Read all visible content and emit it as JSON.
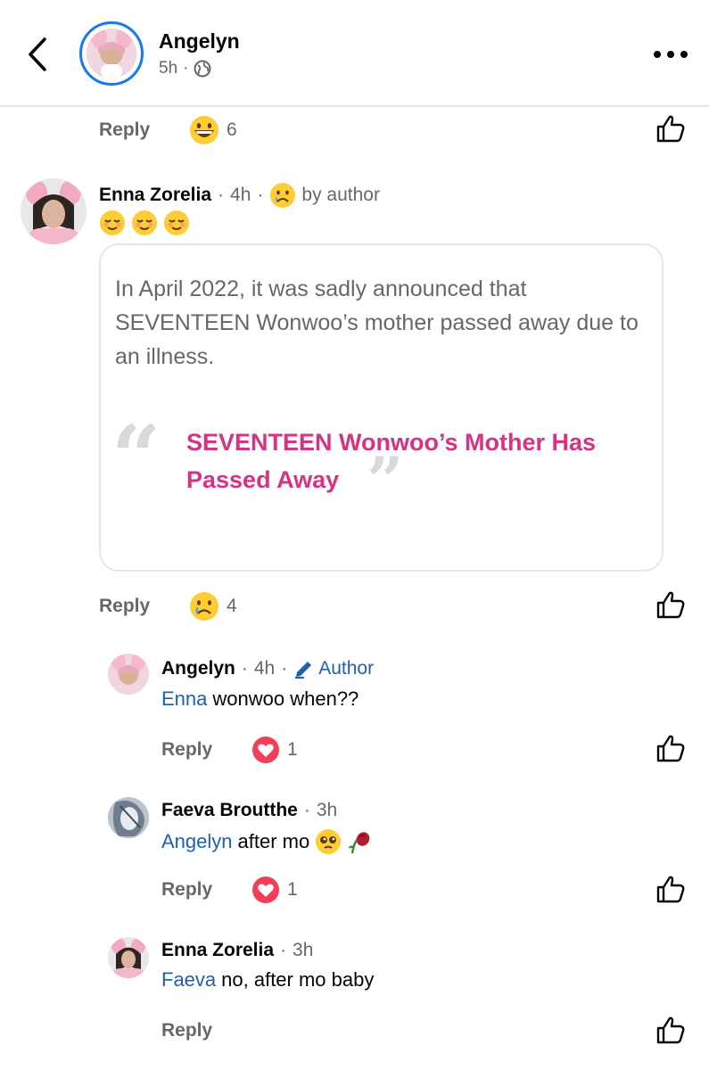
{
  "header": {
    "author": "Angelyn",
    "time": "5h",
    "separator": "·"
  },
  "top_actions": {
    "reply": "Reply",
    "reaction_count": "6",
    "reaction_icon": "grin-emoji"
  },
  "comment1": {
    "name": "Enna Zorelia",
    "time": "4h",
    "by_author": "by author",
    "text_emojis": [
      "relieved-emoji",
      "relieved-emoji",
      "relieved-emoji"
    ],
    "card": {
      "description": "In April 2022, it was sadly announced that SEVENTEEN Wonwoo’s mother passed away due to an illness.",
      "title": "SEVENTEEN Wonwoo’s Mother Has Passed Away"
    },
    "reply": "Reply",
    "reaction_count": "4"
  },
  "reply1": {
    "name": "Angelyn",
    "time": "4h",
    "author_badge": "Author",
    "mention": "Enna",
    "text": "wonwoo when??",
    "reply": "Reply",
    "reaction_count": "1"
  },
  "reply2": {
    "name": "Faeva Broutthe",
    "time": "3h",
    "mention": "Angelyn",
    "text": "after mo",
    "reply": "Reply",
    "reaction_count": "1"
  },
  "reply3": {
    "name": "Enna Zorelia",
    "time": "3h",
    "mention": "Faeva",
    "text": "no, after mo baby",
    "reply": "Reply"
  },
  "colors": {
    "accent": "#1877f2",
    "mention": "#1f5fb3",
    "link_title": "#d63384",
    "meta": "#65676b"
  }
}
